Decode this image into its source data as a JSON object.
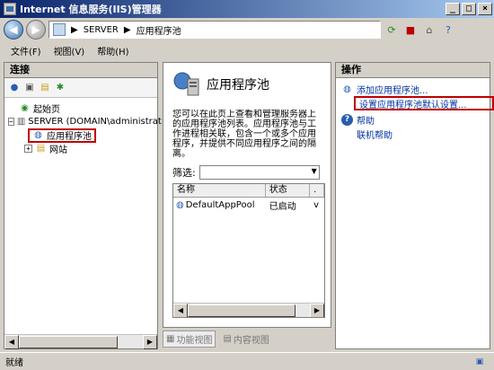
{
  "window": {
    "title": "Internet 信息服务(IIS)管理器"
  },
  "address": {
    "path": [
      "SERVER",
      "应用程序池"
    ]
  },
  "menu": {
    "file": "文件(F)",
    "view": "视图(V)",
    "help": "帮助(H)"
  },
  "connections": {
    "header": "连接",
    "tree": {
      "start": "起始页",
      "server": "SERVER (DOMAIN\\administrat",
      "app_pools": "应用程序池",
      "sites": "网站"
    }
  },
  "main": {
    "title": "应用程序池",
    "description": "您可以在此页上查看和管理服务器上的应用程序池列表。应用程序池与工作进程相关联，包含一个或多个应用程序，并提供不同应用程序之间的隔离。",
    "filter_label": "筛选:",
    "columns": [
      "名称",
      "状态",
      "."
    ],
    "rows": [
      {
        "name": "DefaultAppPool",
        "status": "已启动",
        "extra": "v"
      }
    ],
    "features_view": "功能视图",
    "content_view": "内容视图"
  },
  "actions": {
    "header": "操作",
    "add_pool": "添加应用程序池...",
    "set_defaults": "设置应用程序池默认设置...",
    "help": "帮助",
    "online_help": "联机帮助"
  },
  "status": {
    "text": "就绪"
  },
  "colors": {
    "highlight_box": "#c00000",
    "link": "#0033a0",
    "title_bar_start": "#0a246a"
  }
}
